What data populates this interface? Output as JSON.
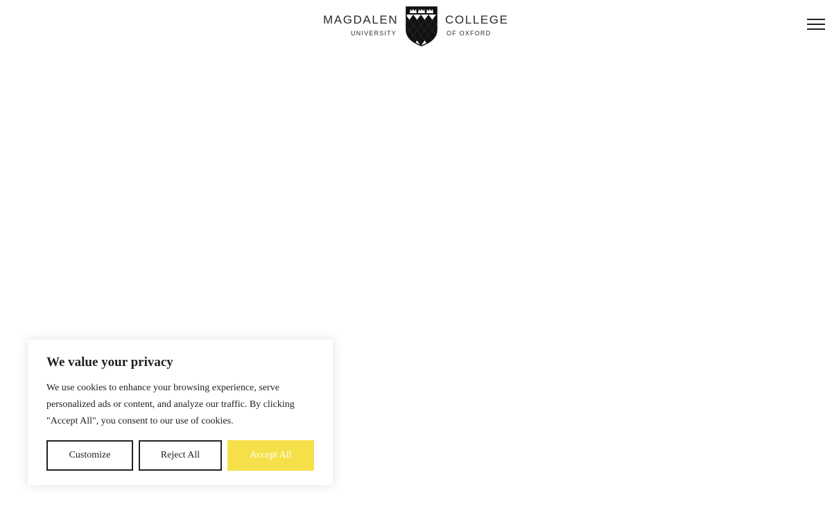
{
  "header": {
    "logo": {
      "left_main": "MAGDALEN",
      "left_sub": "UNIVERSITY",
      "right_main": "COLLEGE",
      "right_sub": "OF OXFORD"
    },
    "menu_icon": "hamburger-menu-icon"
  },
  "cookie_banner": {
    "title": "We value your privacy",
    "text": "We use cookies to enhance your browsing experience, serve personalized ads or content, and analyze our traffic. By clicking \"Accept All\", you consent to our use of cookies.",
    "buttons": {
      "customize": "Customize",
      "reject": "Reject All",
      "accept": "Accept All"
    },
    "colors": {
      "accept_bg": "#f5e04a",
      "text": "#212121"
    }
  }
}
